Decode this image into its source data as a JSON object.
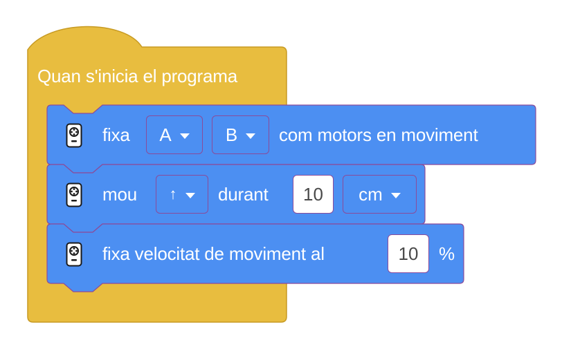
{
  "hat": {
    "label": "Quan s'inicia el programa"
  },
  "block1": {
    "label_pre": "fixa",
    "motor_left": "A",
    "motor_right": "B",
    "label_post": "com motors en moviment"
  },
  "block2": {
    "label_pre": "mou",
    "direction": "↑",
    "label_mid": "durant",
    "amount": "10",
    "unit": "cm"
  },
  "block3": {
    "label_pre": "fixa velocitat de moviment al",
    "speed": "10",
    "suffix": "%"
  },
  "colors": {
    "hat_fill": "#e8bd3f",
    "hat_stroke": "#c79a22",
    "block_fill": "#4c8ff2",
    "block_stroke": "#8a4b9a"
  },
  "icons": {
    "block_icon": "drivetrain-hub-icon"
  }
}
